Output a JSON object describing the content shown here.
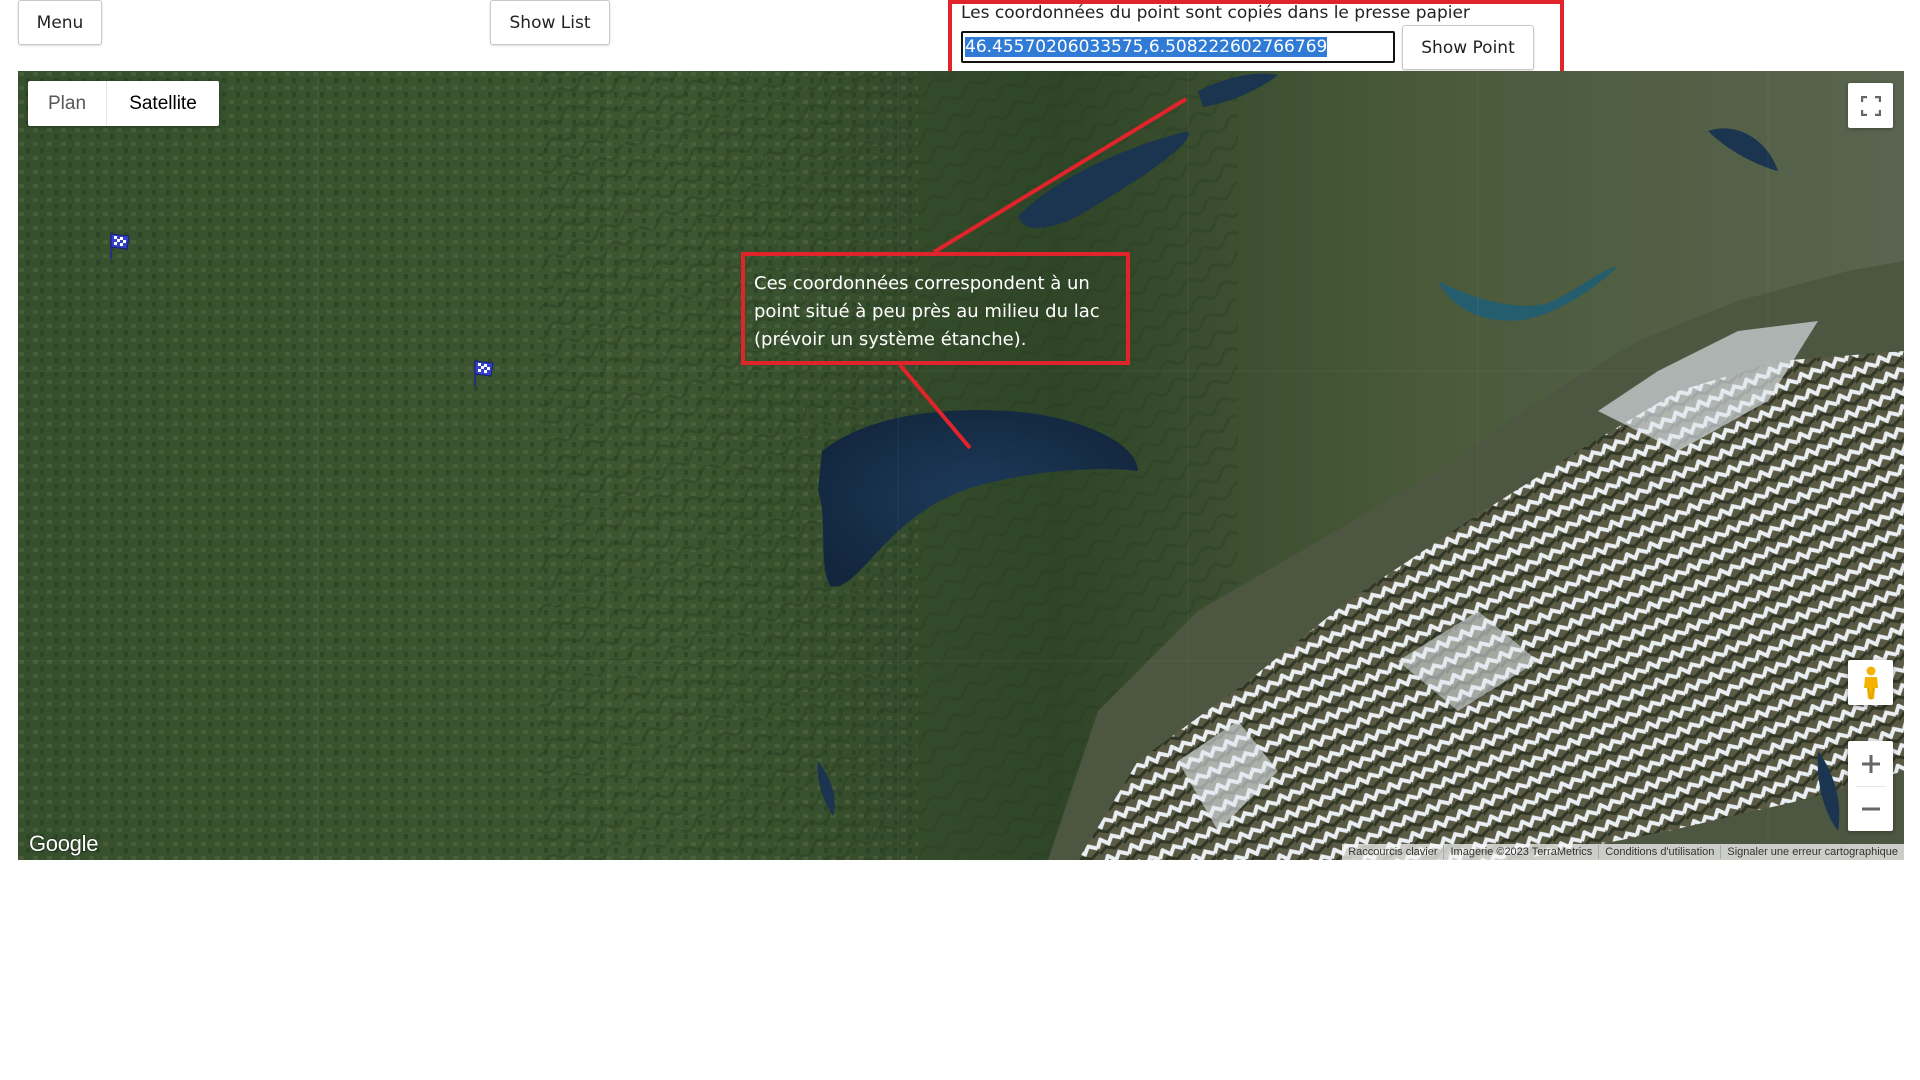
{
  "toolbar": {
    "menu_label": "Menu",
    "show_list_label": "Show List"
  },
  "coords_panel": {
    "message": "Les coordonnées du point sont copiés dans le presse papier",
    "value": "46.45570206033575,6.508222602766769",
    "show_point_label": "Show Point"
  },
  "map": {
    "type_controls": {
      "plan": "Plan",
      "satellite": "Satellite",
      "selected": "Satellite"
    },
    "logo": "Google",
    "attribution": {
      "shortcuts": "Raccourcis clavier",
      "imagery": "Imagerie ©2023 TerraMetrics",
      "terms": "Conditions d'utilisation",
      "report": "Signaler une erreur cartographique"
    },
    "markers": [
      {
        "icon": "checkered-flag-icon"
      },
      {
        "icon": "checkered-flag-icon"
      }
    ],
    "controls": {
      "fullscreen": "fullscreen-icon",
      "pegman": "pegman-icon",
      "zoom_in": "+",
      "zoom_out": "−"
    }
  },
  "annotation": {
    "text": "Ces coordonnées correspondent à un point situé à peu près au milieu du lac (prévoir un système étanche).",
    "color": "#e0242b"
  }
}
